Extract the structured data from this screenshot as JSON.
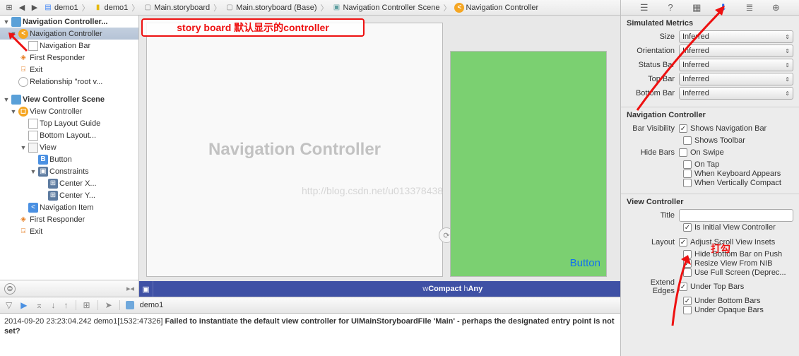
{
  "breadcrumbs": {
    "grid_icon": "⊞",
    "back": "◀",
    "fwd": "▶",
    "items": [
      {
        "icon": "blue",
        "label": "demo1"
      },
      {
        "icon": "yellow",
        "label": "demo1"
      },
      {
        "icon": "gray",
        "label": "Main.storyboard"
      },
      {
        "icon": "gray",
        "label": "Main.storyboard (Base)"
      },
      {
        "icon": "teal",
        "label": "Navigation Controller Scene"
      },
      {
        "icon": "orange",
        "label": "Navigation Controller"
      }
    ]
  },
  "outline": {
    "scenes": [
      {
        "type": "scene",
        "label": "Navigation Controller...",
        "expanded": true,
        "children": [
          {
            "type": "vc",
            "label": "Navigation Controller",
            "selected": true,
            "expanded": true,
            "children": [
              {
                "type": "nav",
                "label": "Navigation Bar"
              }
            ]
          },
          {
            "type": "responder",
            "label": "First Responder"
          },
          {
            "type": "exit",
            "label": "Exit"
          },
          {
            "type": "rel",
            "label": "Relationship \"root v..."
          }
        ]
      },
      {
        "type": "scene",
        "label": "View Controller Scene",
        "expanded": true,
        "children": [
          {
            "type": "vc",
            "label": "View Controller",
            "expanded": true,
            "children": [
              {
                "type": "guide",
                "label": "Top Layout Guide"
              },
              {
                "type": "guide",
                "label": "Bottom Layout..."
              },
              {
                "type": "view",
                "label": "View",
                "expanded": true,
                "children": [
                  {
                    "type": "button",
                    "label": "Button"
                  },
                  {
                    "type": "constraints",
                    "label": "Constraints",
                    "expanded": true,
                    "children": [
                      {
                        "type": "constraint",
                        "label": "Center X..."
                      },
                      {
                        "type": "constraint",
                        "label": "Center Y..."
                      }
                    ]
                  }
                ]
              },
              {
                "type": "navitem",
                "label": "Navigation Item"
              }
            ]
          },
          {
            "type": "responder",
            "label": "First Responder"
          },
          {
            "type": "exit",
            "label": "Exit"
          }
        ]
      }
    ],
    "footer_filter": "⊜",
    "footer_toggle": "▸◂"
  },
  "canvas": {
    "nav_title": "Navigation Controller",
    "button_label": "Button",
    "watermark": "http://blog.csdn.net/u013378438",
    "footer": {
      "size_class": "wCompact hAny",
      "bottom_left_icon": "▣"
    }
  },
  "inspector": {
    "tabs": [
      "☰",
      "?",
      "▦",
      "⬇",
      "≣",
      "⊕"
    ],
    "active_tab": 3,
    "simulated": {
      "title": "Simulated Metrics",
      "size": {
        "label": "Size",
        "value": "Inferred"
      },
      "orientation": {
        "label": "Orientation",
        "value": "Inferred"
      },
      "status_bar": {
        "label": "Status Bar",
        "value": "Inferred"
      },
      "top_bar": {
        "label": "Top Bar",
        "value": "Inferred"
      },
      "bottom_bar": {
        "label": "Bottom Bar",
        "value": "Inferred"
      }
    },
    "nav_controller": {
      "title": "Navigation Controller",
      "bar_visibility_label": "Bar Visibility",
      "shows_nav_bar": {
        "label": "Shows Navigation Bar",
        "checked": true
      },
      "shows_toolbar": {
        "label": "Shows Toolbar",
        "checked": false
      },
      "hide_bars_label": "Hide Bars",
      "on_swipe": {
        "label": "On Swipe",
        "checked": false
      },
      "on_tap": {
        "label": "On Tap",
        "checked": false
      },
      "when_keyboard": {
        "label": "When Keyboard Appears",
        "checked": false
      },
      "when_compact": {
        "label": "When Vertically Compact",
        "checked": false
      }
    },
    "view_controller": {
      "title": "View Controller",
      "title_field": {
        "label": "Title",
        "value": ""
      },
      "is_initial": {
        "label": "Is Initial View Controller",
        "checked": true
      },
      "layout_label": "Layout",
      "adjust_scroll": {
        "label": "Adjust Scroll View Insets",
        "checked": true
      },
      "hide_bottom": {
        "label": "Hide Bottom Bar on Push",
        "checked": false
      },
      "resize_nib": {
        "label": "Resize View From NIB",
        "checked": true
      },
      "full_screen": {
        "label": "Use Full Screen (Deprec...",
        "checked": false
      },
      "extend_label": "Extend Edges",
      "under_top": {
        "label": "Under Top Bars",
        "checked": true
      },
      "under_bottom": {
        "label": "Under Bottom Bars",
        "checked": true
      },
      "under_opaque": {
        "label": "Under Opaque Bars",
        "checked": false
      }
    }
  },
  "debug": {
    "process": "demo1",
    "console_line1": "2014-09-20 23:23:04.242 demo1[1532:47326] ",
    "console_line2": "Failed to instantiate the default view controller for UIMainStoryboardFile 'Main' - perhaps the designated entry point is not set?"
  },
  "annotations": {
    "callout1": "story board 默认显示的controller",
    "label2": "打勾"
  }
}
